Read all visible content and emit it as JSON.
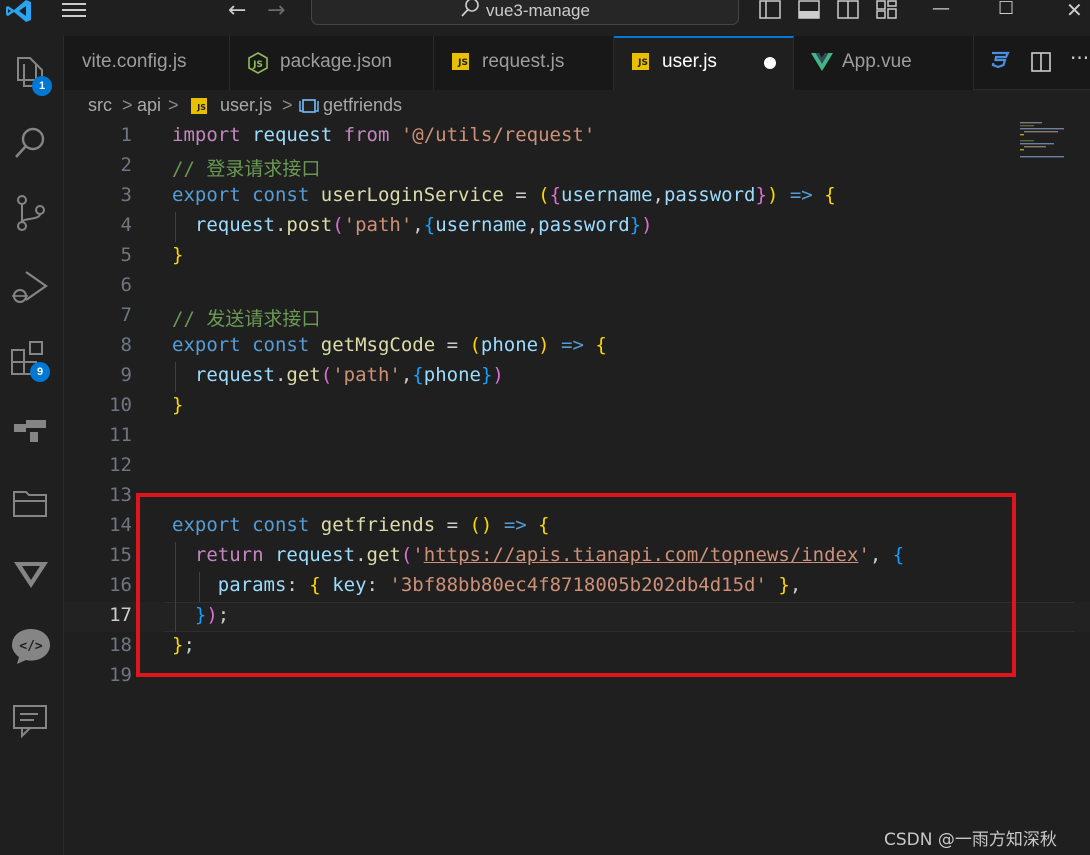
{
  "window": {
    "title": "vue3-manage"
  },
  "activity_bar": {
    "items": [
      {
        "name": "explorer-icon",
        "badge": "1"
      },
      {
        "name": "search-icon"
      },
      {
        "name": "source-control-icon"
      },
      {
        "name": "run-debug-icon"
      },
      {
        "name": "extensions-icon",
        "badge": "9"
      },
      {
        "name": "remote-explorer-icon"
      },
      {
        "name": "folder-icon"
      },
      {
        "name": "vue-icon"
      },
      {
        "name": "code-chat-icon"
      },
      {
        "name": "comment-icon"
      }
    ]
  },
  "tabs": [
    {
      "label": "vite.config.js",
      "icon": "none"
    },
    {
      "label": "package.json",
      "icon": "json-icon"
    },
    {
      "label": "request.js",
      "icon": "js-icon"
    },
    {
      "label": "user.js",
      "icon": "js-icon",
      "active": true,
      "modified": true
    },
    {
      "label": "App.vue",
      "icon": "vue-icon"
    }
  ],
  "breadcrumb": {
    "parts": [
      "src",
      "api",
      "user.js",
      "getfriends"
    ],
    "separator": ">"
  },
  "editor": {
    "current_line": 17,
    "lines": [
      {
        "n": "1",
        "tokens": [
          [
            "kw2",
            "import"
          ],
          [
            "t",
            " "
          ],
          [
            "var",
            "request"
          ],
          [
            "t",
            " "
          ],
          [
            "ctl",
            "from"
          ],
          [
            "t",
            " "
          ],
          [
            "str",
            "'@/utils/request'"
          ]
        ]
      },
      {
        "n": "2",
        "tokens": [
          [
            "cmt",
            "// 登录请求接口"
          ]
        ]
      },
      {
        "n": "3",
        "tokens": [
          [
            "kw",
            "export"
          ],
          [
            "t",
            " "
          ],
          [
            "kw",
            "const"
          ],
          [
            "t",
            " "
          ],
          [
            "fn",
            "userLoginService"
          ],
          [
            "t",
            " = "
          ],
          [
            "b1",
            "("
          ],
          [
            "b2",
            "{"
          ],
          [
            "var",
            "username"
          ],
          [
            "t",
            ","
          ],
          [
            "var",
            "password"
          ],
          [
            "b2",
            "}"
          ],
          [
            "b1",
            ")"
          ],
          [
            "t",
            " "
          ],
          [
            "kw",
            "=>"
          ],
          [
            "t",
            " "
          ],
          [
            "b1",
            "{"
          ]
        ]
      },
      {
        "n": "4",
        "tokens": [
          [
            "t",
            "  "
          ],
          [
            "var",
            "request"
          ],
          [
            "t",
            "."
          ],
          [
            "fn",
            "post"
          ],
          [
            "b2",
            "("
          ],
          [
            "str",
            "'path'"
          ],
          [
            "t",
            ","
          ],
          [
            "b3",
            "{"
          ],
          [
            "var",
            "username"
          ],
          [
            "t",
            ","
          ],
          [
            "var",
            "password"
          ],
          [
            "b3",
            "}"
          ],
          [
            "b2",
            ")"
          ]
        ]
      },
      {
        "n": "5",
        "tokens": [
          [
            "b1",
            "}"
          ]
        ]
      },
      {
        "n": "6",
        "tokens": []
      },
      {
        "n": "7",
        "tokens": [
          [
            "cmt",
            "// 发送请求接口"
          ]
        ]
      },
      {
        "n": "8",
        "tokens": [
          [
            "kw",
            "export"
          ],
          [
            "t",
            " "
          ],
          [
            "kw",
            "const"
          ],
          [
            "t",
            " "
          ],
          [
            "fn",
            "getMsgCode"
          ],
          [
            "t",
            " = "
          ],
          [
            "b1",
            "("
          ],
          [
            "var",
            "phone"
          ],
          [
            "b1",
            ")"
          ],
          [
            "t",
            " "
          ],
          [
            "kw",
            "=>"
          ],
          [
            "t",
            " "
          ],
          [
            "b1",
            "{"
          ]
        ]
      },
      {
        "n": "9",
        "tokens": [
          [
            "t",
            "  "
          ],
          [
            "var",
            "request"
          ],
          [
            "t",
            "."
          ],
          [
            "fn",
            "get"
          ],
          [
            "b2",
            "("
          ],
          [
            "str",
            "'path'"
          ],
          [
            "t",
            ","
          ],
          [
            "b3",
            "{"
          ],
          [
            "var",
            "phone"
          ],
          [
            "b3",
            "}"
          ],
          [
            "b2",
            ")"
          ]
        ]
      },
      {
        "n": "10",
        "tokens": [
          [
            "b1",
            "}"
          ]
        ]
      },
      {
        "n": "11",
        "tokens": []
      },
      {
        "n": "12",
        "tokens": []
      },
      {
        "n": "13",
        "tokens": []
      },
      {
        "n": "14",
        "tokens": [
          [
            "kw",
            "export"
          ],
          [
            "t",
            " "
          ],
          [
            "kw",
            "const"
          ],
          [
            "t",
            " "
          ],
          [
            "fn",
            "getfriends"
          ],
          [
            "t",
            " = "
          ],
          [
            "b1",
            "()"
          ],
          [
            "t",
            " "
          ],
          [
            "kw",
            "=>"
          ],
          [
            "t",
            " "
          ],
          [
            "b1",
            "{"
          ]
        ]
      },
      {
        "n": "15",
        "tokens": [
          [
            "t",
            "  "
          ],
          [
            "ctl",
            "return"
          ],
          [
            "t",
            " "
          ],
          [
            "var",
            "request"
          ],
          [
            "t",
            "."
          ],
          [
            "fn",
            "get"
          ],
          [
            "b2",
            "("
          ],
          [
            "str",
            "'"
          ],
          [
            "url",
            "https://apis.tianapi.com/topnews/index"
          ],
          [
            "str",
            "'"
          ],
          [
            "t",
            ", "
          ],
          [
            "b3",
            "{"
          ]
        ]
      },
      {
        "n": "16",
        "tokens": [
          [
            "t",
            "    "
          ],
          [
            "var",
            "params"
          ],
          [
            "t",
            ": "
          ],
          [
            "b1",
            "{"
          ],
          [
            "t",
            " "
          ],
          [
            "var",
            "key"
          ],
          [
            "t",
            ": "
          ],
          [
            "str",
            "'3bf88bb80ec4f8718005b202db4d15d'"
          ],
          [
            "t",
            " "
          ],
          [
            "b1",
            "}"
          ],
          [
            "t",
            ","
          ]
        ]
      },
      {
        "n": "17",
        "tokens": [
          [
            "t",
            "  "
          ],
          [
            "b3",
            "}"
          ],
          [
            "b2",
            ")"
          ],
          [
            "t",
            ";"
          ]
        ]
      },
      {
        "n": "18",
        "tokens": [
          [
            "b1",
            "}"
          ],
          [
            "t",
            ";"
          ]
        ]
      },
      {
        "n": "19",
        "tokens": []
      }
    ]
  },
  "watermark": "CSDN @一雨方知深秋",
  "colors": {
    "accent": "#0078d4",
    "highlight_box": "#e0141c",
    "keyword": "#569cd6",
    "control": "#c586c0",
    "function": "#dcdcaa",
    "variable": "#9cdcfe",
    "string": "#ce9178",
    "comment": "#6a9955"
  }
}
